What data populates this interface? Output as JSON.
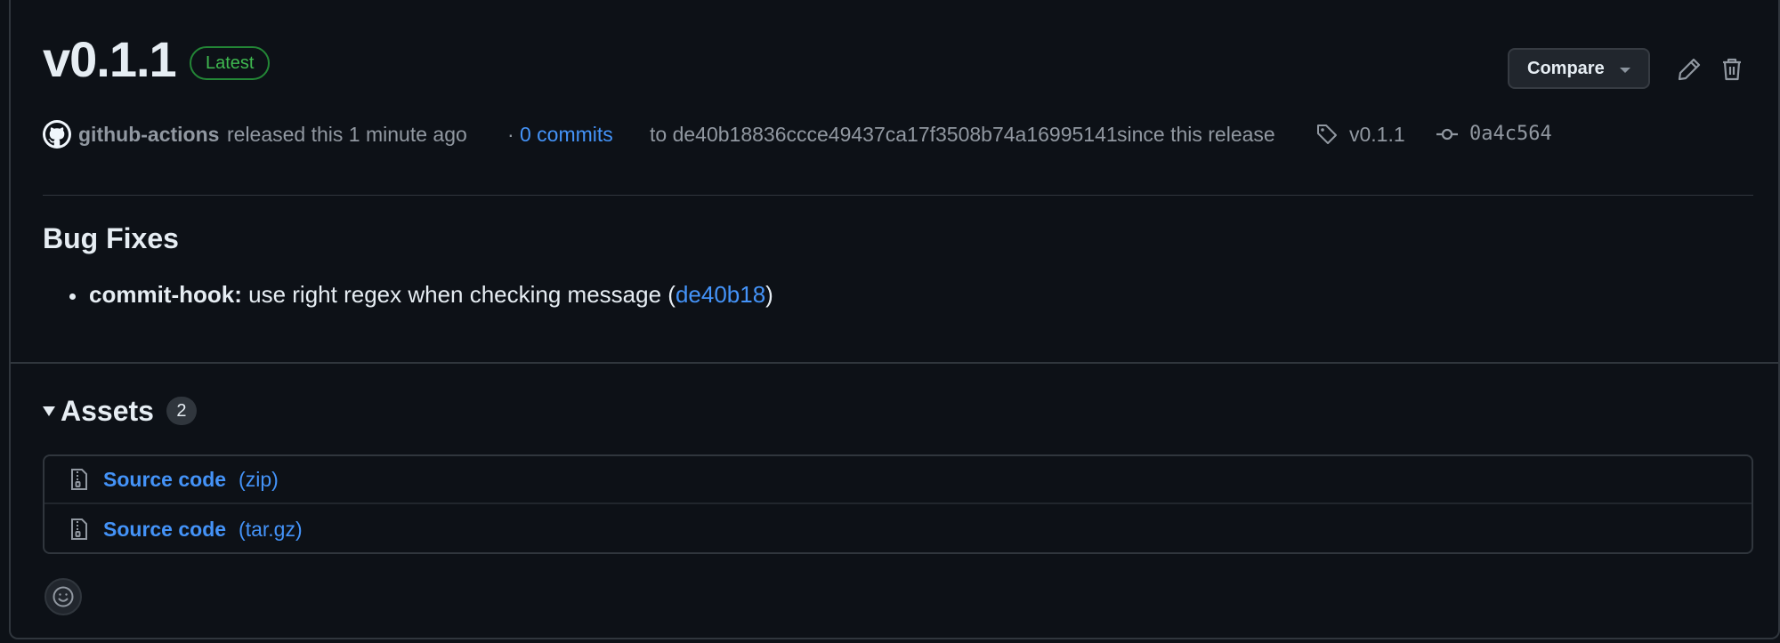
{
  "release": {
    "title": "v0.1.1",
    "badge": "Latest",
    "compare_label": "Compare"
  },
  "meta": {
    "author": "github-actions",
    "released_text": "released this 1 minute ago",
    "dot": "·",
    "commits_link": "0 commits",
    "to_text": "to de40b18836ccce49437ca17f3508b74a16995141",
    "since_text": "since this release",
    "tag": "v0.1.1",
    "commit_sha": "0a4c564"
  },
  "notes": {
    "heading": "Bug Fixes",
    "items": [
      {
        "scope": "commit-hook:",
        "text": "use right regex when checking message (",
        "link": "de40b18",
        "close": ")"
      }
    ]
  },
  "assets": {
    "title": "Assets",
    "count": "2",
    "items": [
      {
        "name": "Source code",
        "ext": "(zip)"
      },
      {
        "name": "Source code",
        "ext": "(tar.gz)"
      }
    ]
  },
  "colors": {
    "background": "#0d1117",
    "border": "#30363d",
    "link": "#4493f8",
    "badge_green": "#3fb950",
    "muted_text": "#9198a1"
  },
  "icons": {
    "avatar": "github-mark-icon",
    "edit": "pencil-icon",
    "delete": "trash-icon",
    "tag": "tag-icon",
    "commit": "git-commit-icon",
    "file": "file-zip-icon",
    "reaction": "smiley-icon"
  }
}
